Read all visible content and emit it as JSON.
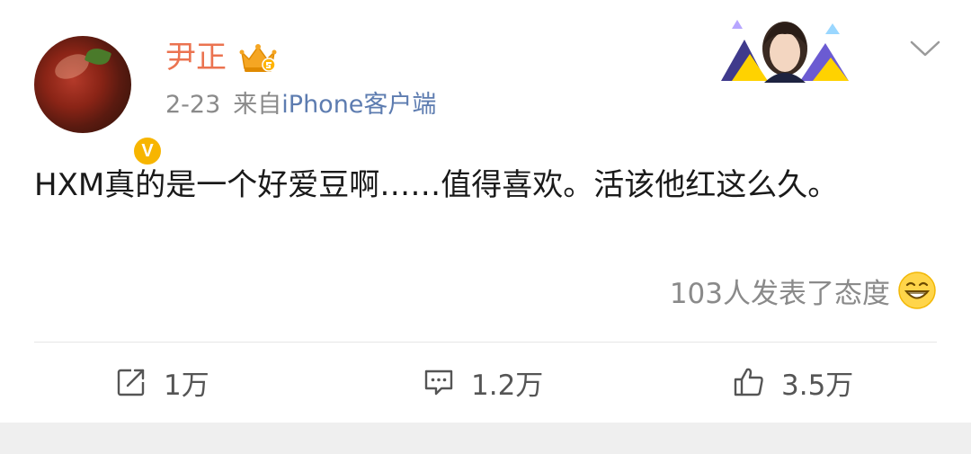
{
  "post": {
    "author": "尹正",
    "date": "2-23",
    "source_prefix": "来自",
    "source": "iPhone客户端",
    "text": "HXM真的是一个好爱豆啊……值得喜欢。活该他红这么久。",
    "reactions_label": "103人发表了态度"
  },
  "actions": {
    "repost_count": "1万",
    "comment_count": "1.2万",
    "like_count": "3.5万"
  },
  "icons": {
    "verified": "verified-v-icon",
    "crown": "crown-icon",
    "chevron": "chevron-down-icon",
    "emoji": "grin-emoji-icon",
    "repost": "repost-icon",
    "comment": "comment-icon",
    "like": "thumbs-up-icon"
  },
  "colors": {
    "username": "#eb7350",
    "source_link": "#5d7cb0",
    "muted_text": "#8a8a8a",
    "badge": "#f7b500"
  }
}
